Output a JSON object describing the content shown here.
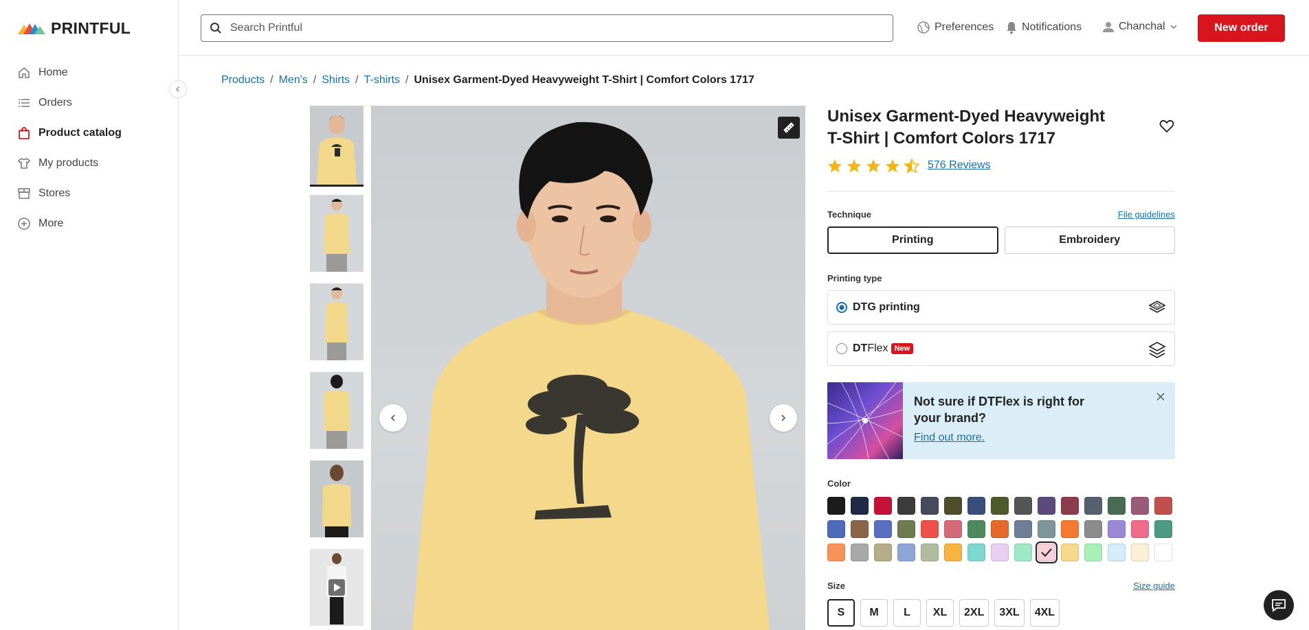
{
  "brand": {
    "name": "PRINTFUL"
  },
  "sidebar": {
    "items": [
      {
        "label": "Home",
        "icon": "home-icon"
      },
      {
        "label": "Orders",
        "icon": "list-icon"
      },
      {
        "label": "Product catalog",
        "icon": "shopping-bag-icon",
        "active": true
      },
      {
        "label": "My products",
        "icon": "tshirt-icon"
      },
      {
        "label": "Stores",
        "icon": "store-icon"
      },
      {
        "label": "More",
        "icon": "plus-circle-icon"
      }
    ]
  },
  "header": {
    "search_placeholder": "Search Printful",
    "preferences": "Preferences",
    "notifications": "Notifications",
    "user": "Chanchal",
    "new_order": "New order"
  },
  "breadcrumb": [
    "Products",
    "Men's",
    "Shirts",
    "T-shirts"
  ],
  "breadcrumb_current": "Unisex Garment-Dyed Heavyweight T-Shirt | Comfort Colors 1717",
  "product": {
    "title": "Unisex Garment-Dyed Heavyweight T-Shirt | Comfort Colors 1717",
    "rating": 4.5,
    "reviews": "576 Reviews"
  },
  "technique": {
    "label": "Technique",
    "link": "File guidelines",
    "options": [
      "Printing",
      "Embroidery"
    ],
    "selected": "Printing"
  },
  "printing_type": {
    "label": "Printing type",
    "dtg": "DTG printing",
    "dtflex_a": "DT",
    "dtflex_b": "Flex",
    "new_badge": "New"
  },
  "promo": {
    "title": "Not sure if DTFlex is right for your brand?",
    "link": "Find out more."
  },
  "color": {
    "label": "Color",
    "swatches": [
      "#1b1b1b",
      "#1f2a44",
      "#c3113a",
      "#3b3b3b",
      "#474a5c",
      "#4e4f2a",
      "#3a4e7a",
      "#4f5a2a",
      "#555555",
      "#5b4a7a",
      "#8c3c4c",
      "#56606e",
      "#4a6a52",
      "#9a5a7a",
      "#c0504e",
      "#4d6bb8",
      "#8b6548",
      "#5a6fc0",
      "#6e7a50",
      "#f0504c",
      "#d46a78",
      "#4f8a5e",
      "#e4692b",
      "#6f7e96",
      "#7e959a",
      "#f47a30",
      "#8c8c8c",
      "#9a88d6",
      "#f06a8a",
      "#4c9a82",
      "#f7935a",
      "#a8a8a8",
      "#b5ad88",
      "#8ea6d6",
      "#b0bca0",
      "#f8b440",
      "#7ed8d0",
      "#e8d0f2",
      "#9ee8c8",
      "#f8d0da",
      "#f7d98b",
      "#a8f0b8",
      "#d6ecf8",
      "#fbf0d6",
      "#ffffff"
    ],
    "selected_index": 39
  },
  "size": {
    "label": "Size",
    "link": "Size guide",
    "options": [
      "S",
      "M",
      "L",
      "XL",
      "2XL",
      "3XL",
      "4XL"
    ],
    "selected": "S"
  }
}
